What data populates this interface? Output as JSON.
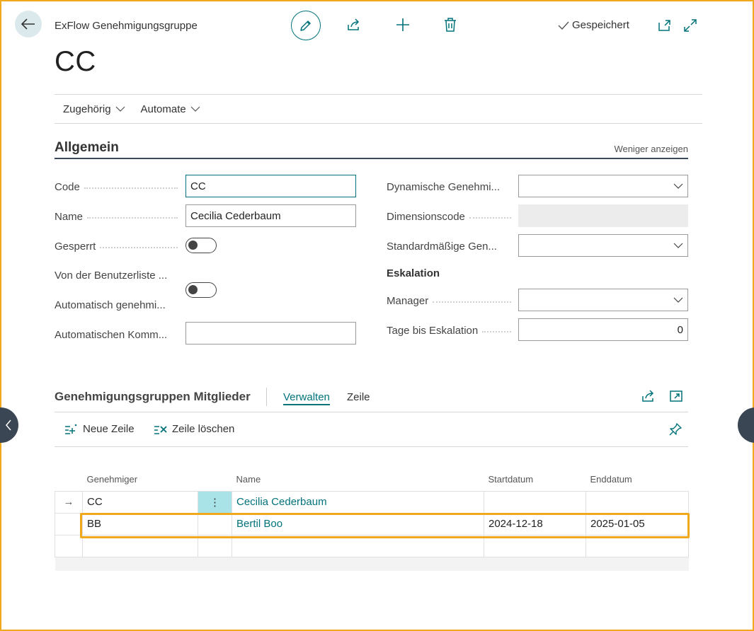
{
  "header": {
    "kicker": "ExFlow Genehmigungsgruppe",
    "title": "CC",
    "saved_label": "Gespeichert"
  },
  "actions": [
    {
      "label": "Zugehörig"
    },
    {
      "label": "Automate"
    }
  ],
  "general": {
    "title": "Allgemein",
    "toggle_link": "Weniger anzeigen",
    "left_fields": {
      "code": {
        "label": "Code",
        "value": "CC"
      },
      "name": {
        "label": "Name",
        "value": "Cecilia Cederbaum"
      },
      "blocked": {
        "label": "Gesperrt",
        "on": false
      },
      "from_userlist": {
        "label": "Von der Benutzerliste ...",
        "on": false
      },
      "auto_approve": {
        "label": "Automatisch genehmi...",
        "on": false
      },
      "auto_comment": {
        "label": "Automatischen Komm...",
        "value": ""
      }
    },
    "right_fields": {
      "dynamic": {
        "label": "Dynamische Genehmi...",
        "value": ""
      },
      "dimension": {
        "label": "Dimensionscode",
        "value": ""
      },
      "default_gen": {
        "label": "Standardmäßige Gen...",
        "value": ""
      },
      "escalation_heading": "Eskalation",
      "manager": {
        "label": "Manager",
        "value": ""
      },
      "days": {
        "label": "Tage bis Eskalation",
        "value": "0"
      }
    }
  },
  "members": {
    "title": "Genehmigungsgruppen Mitglieder",
    "tabs": [
      "Verwalten",
      "Zeile"
    ],
    "toolbar": {
      "new_line": "Neue Zeile",
      "delete_line": "Zeile löschen"
    },
    "columns": [
      "Genehmiger",
      "",
      "Name",
      "Startdatum",
      "Enddatum"
    ],
    "rows": [
      {
        "marker": "→",
        "approver": "CC",
        "menu": "⋮",
        "name": "Cecilia Cederbaum",
        "start": "",
        "end": ""
      },
      {
        "marker": "",
        "approver": "BB",
        "menu": "",
        "name": "Bertil Boo",
        "start": "2024-12-18",
        "end": "2025-01-05"
      },
      {
        "marker": "",
        "approver": "",
        "menu": "",
        "name": "",
        "start": "",
        "end": ""
      }
    ]
  },
  "colors": {
    "accent": "#00727a",
    "highlight": "#f0a81c",
    "section_rule": "#3a4a5a"
  }
}
